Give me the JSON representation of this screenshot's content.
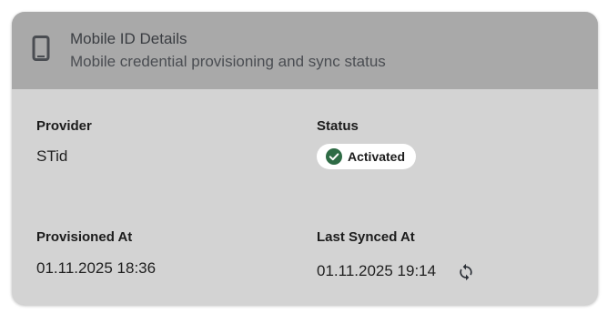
{
  "header": {
    "icon": "mobile-phone-icon",
    "title": "Mobile ID Details",
    "subtitle": "Mobile credential provisioning and sync status"
  },
  "fields": {
    "provider": {
      "label": "Provider",
      "value": "STid"
    },
    "status": {
      "label": "Status",
      "value": "Activated",
      "icon": "check-circle-icon",
      "color": "#2e6b45"
    },
    "provisioned_at": {
      "label": "Provisioned At",
      "value": "01.11.2025 18:36"
    },
    "last_synced_at": {
      "label": "Last Synced At",
      "value": "01.11.2025 19:14",
      "action_icon": "sync-icon"
    }
  },
  "colors": {
    "card_background": "#d3d3d3",
    "header_background": "#a9a9a9",
    "status_pill_background": "#ffffff",
    "status_success": "#2e6b45"
  }
}
